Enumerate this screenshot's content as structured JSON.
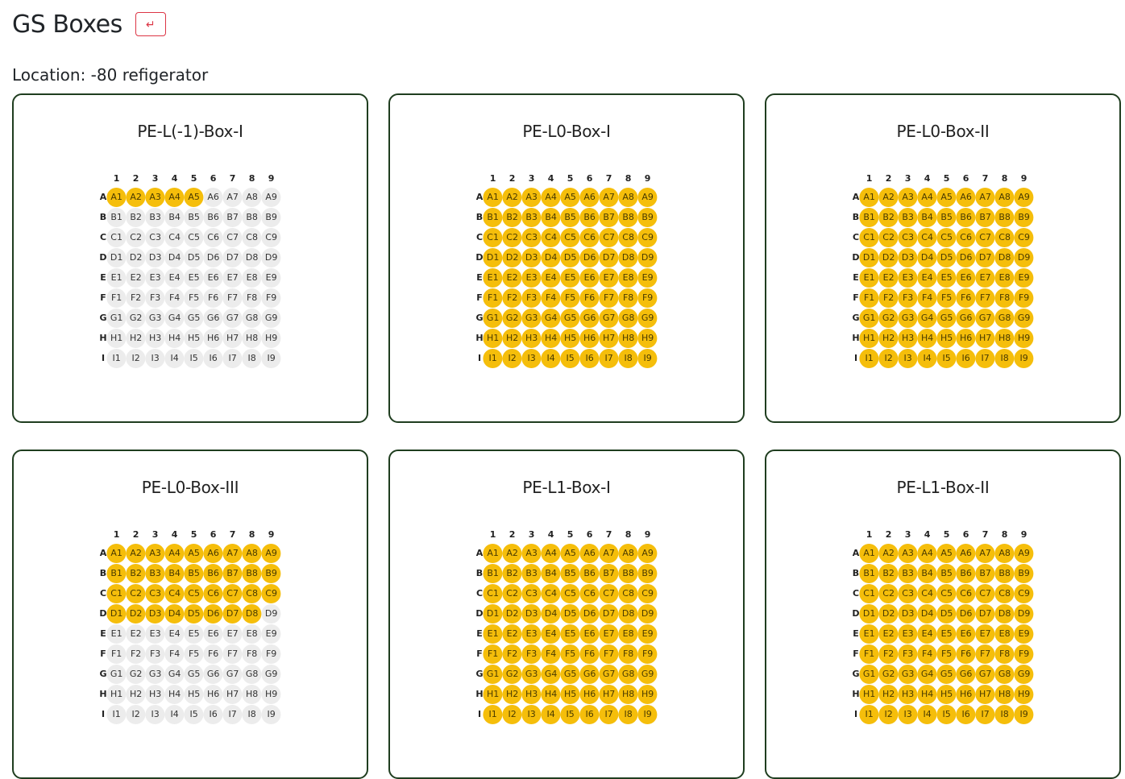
{
  "page": {
    "title": "GS Boxes",
    "back_icon": "↵",
    "location": "Location: -80 refigerator"
  },
  "colors": {
    "filled": "#f5be0b",
    "empty": "#ececec",
    "border": "#1f3d1f",
    "back": "#dc3545"
  },
  "rows": [
    "A",
    "B",
    "C",
    "D",
    "E",
    "F",
    "G",
    "H",
    "I"
  ],
  "cols": [
    "1",
    "2",
    "3",
    "4",
    "5",
    "6",
    "7",
    "8",
    "9"
  ],
  "boxes": [
    {
      "name": "PE-L(-1)-Box-I",
      "filled": [
        "A1",
        "A2",
        "A3",
        "A4",
        "A5"
      ]
    },
    {
      "name": "PE-L0-Box-I",
      "filled": "all"
    },
    {
      "name": "PE-L0-Box-II",
      "filled": "all"
    },
    {
      "name": "PE-L0-Box-III",
      "filled": [
        "A1",
        "A2",
        "A3",
        "A4",
        "A5",
        "A6",
        "A7",
        "A8",
        "A9",
        "B1",
        "B2",
        "B3",
        "B4",
        "B5",
        "B6",
        "B7",
        "B8",
        "B9",
        "C1",
        "C2",
        "C3",
        "C4",
        "C5",
        "C6",
        "C7",
        "C8",
        "C9",
        "D1",
        "D2",
        "D3",
        "D4",
        "D5",
        "D6",
        "D7",
        "D8"
      ]
    },
    {
      "name": "PE-L1-Box-I",
      "filled": "all"
    },
    {
      "name": "PE-L1-Box-II",
      "filled": "all"
    }
  ]
}
